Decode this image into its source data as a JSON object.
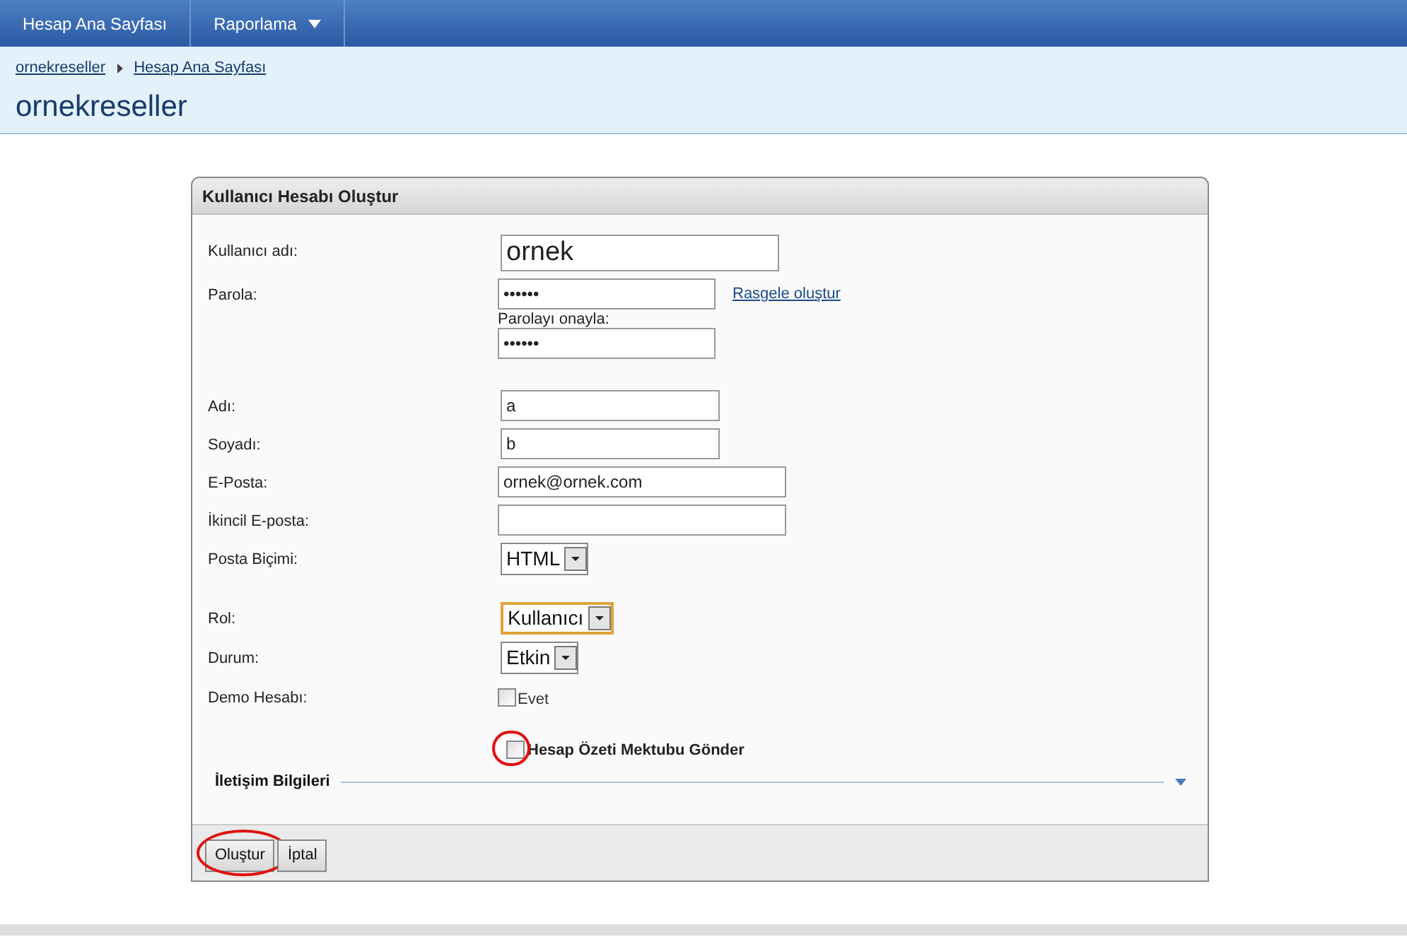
{
  "nav": [
    {
      "label": "Hesap Ana Sayfası",
      "dropdown": false
    },
    {
      "label": "Raporlama",
      "dropdown": true
    }
  ],
  "breadcrumb": [
    "ornekreseller",
    "Hesap Ana Sayfası"
  ],
  "page_title": "ornekreseller",
  "panel": {
    "title": "Kullanıcı Hesabı Oluştur",
    "groups": [
      [
        {
          "kind": "text",
          "label": "Kullanıcı adı:",
          "value": "ornek",
          "large": true
        },
        {
          "kind": "password",
          "label": "Parola:",
          "value": "••••••",
          "link": "Rasgele oluştur",
          "confirm_label": "Parolayı onayla:",
          "confirm_value": "••••••"
        }
      ],
      [
        {
          "kind": "text",
          "label": "Adı:",
          "value": "a",
          "large": false
        },
        {
          "kind": "text",
          "label": "Soyadı:",
          "value": "b",
          "large": false
        },
        {
          "kind": "email",
          "label": "E-Posta:",
          "value": "ornek@ornek.com"
        },
        {
          "kind": "email",
          "label": "İkincil E-posta:"
        },
        {
          "kind": "select",
          "label": "Posta Biçimi:",
          "value": "HTML",
          "focused": false
        }
      ],
      [
        {
          "kind": "select",
          "label": "Rol:",
          "value": "Kullanıcı",
          "focused": true
        },
        {
          "kind": "select",
          "label": "Durum:",
          "value": "Etkin",
          "focused": false
        },
        {
          "kind": "checkbox",
          "label": "Demo Hesabı:",
          "option": "Evet",
          "checked": false
        }
      ]
    ],
    "summary_checkbox": {
      "label": "Hesap Özeti Mektubu Gönder",
      "checked": false,
      "circled": true
    },
    "section": {
      "title": "İletişim Bilgileri",
      "expanded": false
    },
    "buttons": [
      {
        "label": "Oluştur",
        "circled": true
      },
      {
        "label": "İptal",
        "circled": false
      }
    ]
  }
}
